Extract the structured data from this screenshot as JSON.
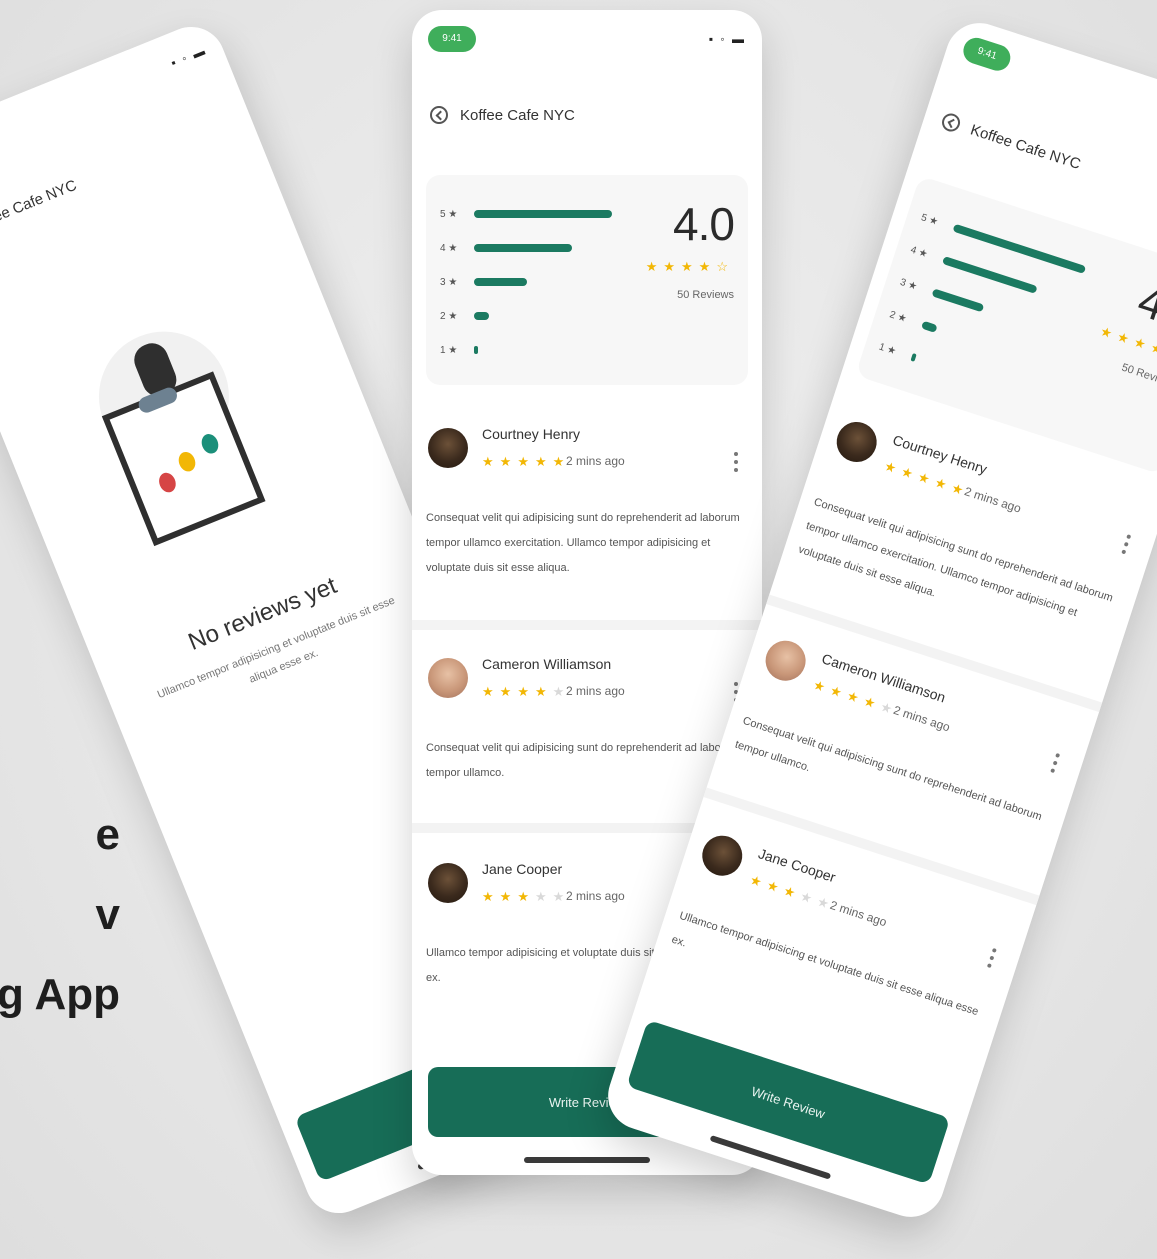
{
  "side_title": [
    "e",
    "v",
    "g App"
  ],
  "status": {
    "time": "9:41",
    "icons": "▪ ◦ ▬"
  },
  "place": {
    "name": "Koffee Cafe NYC"
  },
  "summary": {
    "score": "4.0",
    "stars": "★★★★☆",
    "count": "50 Reviews",
    "breakdown": [
      {
        "label": "5 ★",
        "level": 0.92
      },
      {
        "label": "4 ★",
        "level": 0.65
      },
      {
        "label": "3 ★",
        "level": 0.35
      },
      {
        "label": "2 ★",
        "level": 0.1
      },
      {
        "label": "1 ★",
        "level": 0.02
      }
    ]
  },
  "reviews": [
    {
      "name": "Courtney Henry",
      "rating": 5,
      "time": "2 mins ago",
      "text": "Consequat velit qui adipisicing sunt do reprehenderit ad laborum tempor ullamco exercitation. Ullamco tempor adipisicing et voluptate duis sit esse aliqua."
    },
    {
      "name": "Cameron Williamson",
      "rating": 4,
      "time": "2 mins ago",
      "text": "Consequat velit qui adipisicing sunt do reprehenderit ad laborum tempor ullamco."
    },
    {
      "name": "Jane Cooper",
      "rating": 3,
      "time": "2 mins ago",
      "text": "Ullamco tempor adipisicing et voluptate duis sit esse aliqua esse ex."
    }
  ],
  "empty_state": {
    "title": "No reviews yet",
    "subtitle": "Ullamco tempor adipisicing et voluptate duis sit esse aliqua esse ex."
  },
  "cta": {
    "label": "Write Review"
  }
}
